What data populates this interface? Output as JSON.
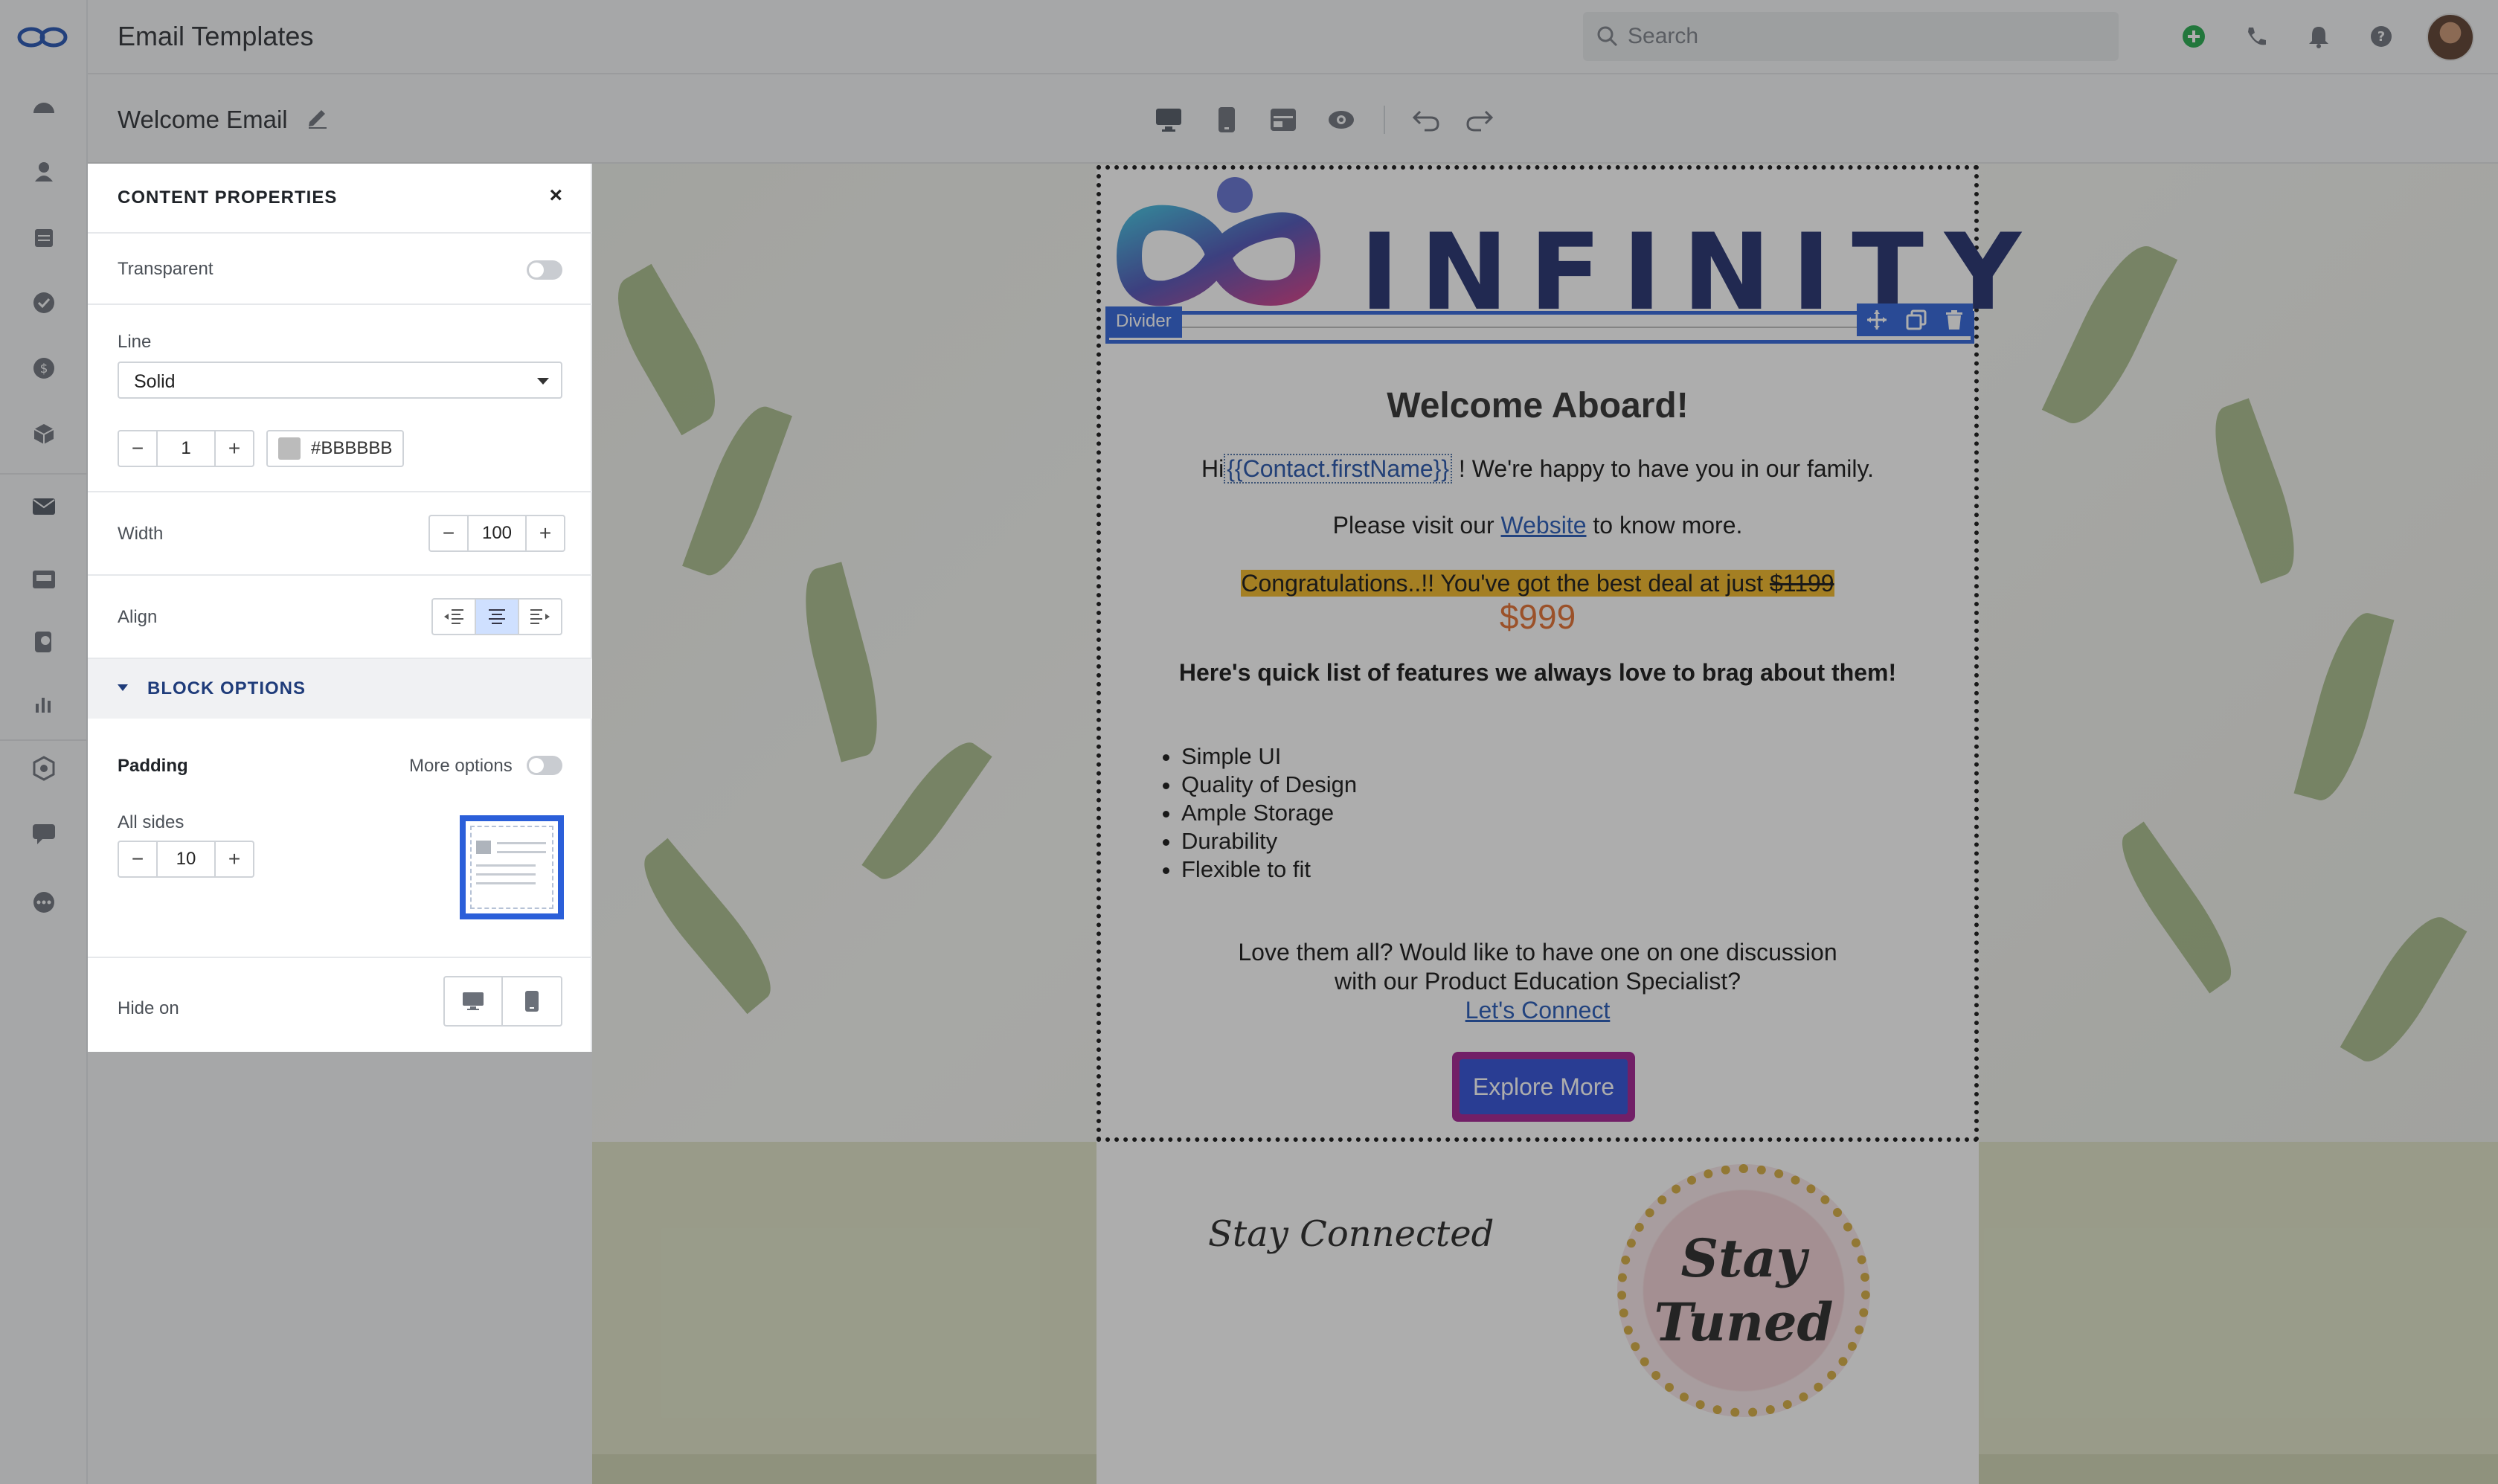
{
  "app": {
    "title": "Email Templates",
    "search_placeholder": "Search"
  },
  "editor": {
    "template_name": "Welcome Email"
  },
  "panel": {
    "header": "CONTENT PROPERTIES",
    "close_label": "×",
    "transparent_label": "Transparent",
    "transparent_on": false,
    "line_label": "Line",
    "line_style": "Solid",
    "thickness_value": "1",
    "color_value": "#BBBBBB",
    "width_label": "Width",
    "width_value": "100",
    "align_label": "Align",
    "align_selected": "center",
    "block_options_label": "BLOCK OPTIONS",
    "padding_label": "Padding",
    "more_options_label": "More options",
    "more_options_on": false,
    "all_sides_label": "All sides",
    "all_sides_value": "10",
    "hide_on_label": "Hide on",
    "stepper_minus": "−",
    "stepper_plus": "+"
  },
  "email": {
    "brand": "INFINITY",
    "divider_tag": "Divider",
    "title": "Welcome Aboard!",
    "greeting_pre": "Hi",
    "merge_field": "{{Contact.firstName}}",
    "greeting_post": "! We're happy to have you in our family.",
    "visit_pre": "Please visit our ",
    "visit_link": "Website",
    "visit_post": " to know more.",
    "deal_text": "Congratulations..!! You've got the best deal at just ",
    "old_price": "$1199",
    "new_price": "$999",
    "features_heading": "Here's quick list of features we always love to brag about them!",
    "features": [
      "Simple UI",
      "Quality of Design",
      "Ample Storage",
      "Durability",
      "Flexible to fit"
    ],
    "discussion_line1": "Love them all? Would like to have one on one discussion",
    "discussion_line2": "with our Product Education Specialist?",
    "connect_link": "Let's Connect",
    "cta_label": "Explore More",
    "stay_connected": "Stay Connected",
    "badge_line1": "Stay",
    "badge_line2": "Tuned"
  },
  "colors": {
    "accent": "#2b5fd9",
    "highlight": "#f1b521",
    "price": "#e26b2b",
    "cta_border": "#a01a8e",
    "cta_fill": "#2b4bd6"
  },
  "icons": {
    "rail": [
      "dashboard-icon",
      "contacts-icon",
      "calendar-icon",
      "tasks-icon",
      "dollar-icon",
      "box-icon",
      "mail-icon",
      "inbox-icon",
      "phone-chat-icon",
      "reports-icon",
      "automation-icon",
      "chat-icon",
      "more-icon"
    ],
    "topbar": [
      "add-icon",
      "phone-icon",
      "bell-icon",
      "help-icon"
    ],
    "toolbar": [
      "desktop-icon",
      "mobile-icon",
      "layout-icon",
      "preview-icon",
      "undo-icon",
      "redo-icon"
    ]
  }
}
